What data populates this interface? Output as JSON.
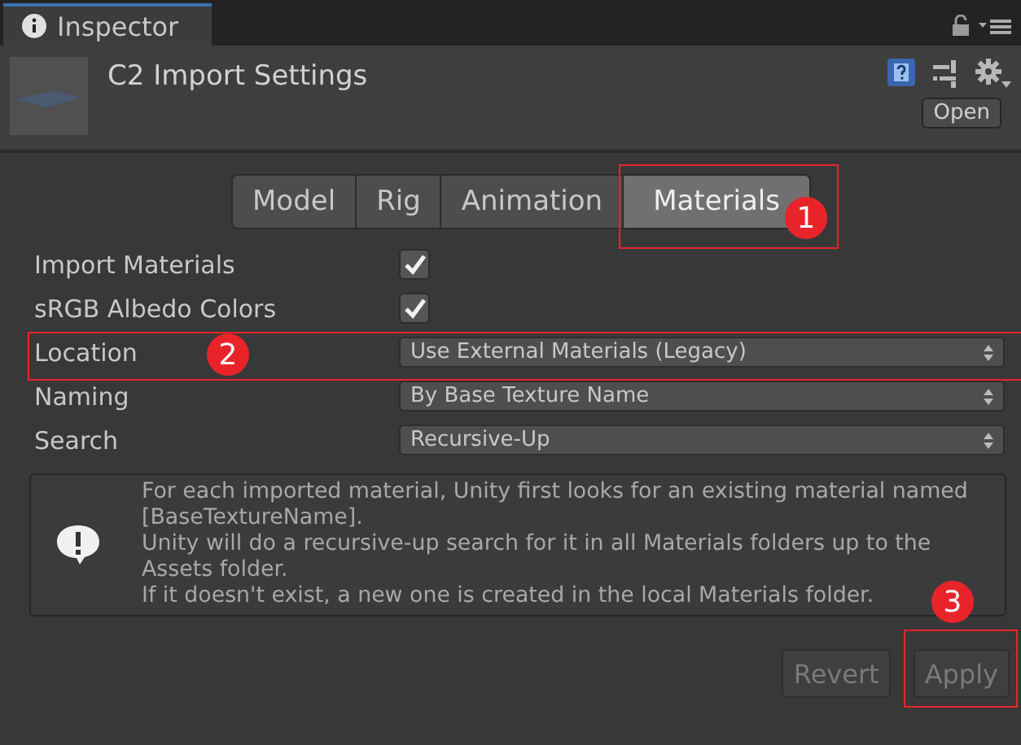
{
  "window": {
    "tab": "Inspector",
    "title": "C2 Import Settings",
    "open_button": "Open"
  },
  "tabs": [
    {
      "label": "Model",
      "selected": false
    },
    {
      "label": "Rig",
      "selected": false
    },
    {
      "label": "Animation",
      "selected": false
    },
    {
      "label": "Materials",
      "selected": true
    }
  ],
  "fields": [
    {
      "kind": "checkbox",
      "label": "Import Materials",
      "checked": true
    },
    {
      "kind": "checkbox",
      "label": "sRGB Albedo Colors",
      "checked": true
    },
    {
      "kind": "dropdown",
      "label": "Location",
      "value": "Use External Materials (Legacy)"
    },
    {
      "kind": "dropdown",
      "label": "Naming",
      "value": "By Base Texture Name"
    },
    {
      "kind": "dropdown",
      "label": "Search",
      "value": "Recursive-Up"
    }
  ],
  "help_box": {
    "lines": [
      "For each imported material, Unity first looks for an existing material named [BaseTextureName].",
      "Unity will do a recursive-up search for it in all Materials folders up to the Assets folder.",
      "If it doesn't exist, a new one is created in the local Materials folder."
    ]
  },
  "buttons": [
    {
      "label": "Revert",
      "disabled": true
    },
    {
      "label": "Apply",
      "disabled": true
    }
  ],
  "annotations": [
    {
      "number": "1"
    },
    {
      "number": "2"
    },
    {
      "number": "3"
    }
  ]
}
